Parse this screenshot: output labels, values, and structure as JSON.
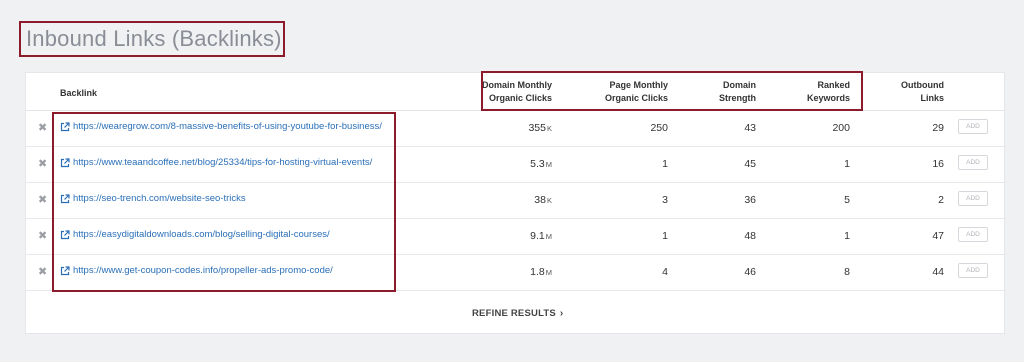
{
  "page_title": "Inbound Links (Backlinks)",
  "columns": {
    "backlink": "Backlink",
    "domain_monthly_clicks": [
      "Domain Monthly",
      "Organic Clicks"
    ],
    "page_monthly_clicks": [
      "Page Monthly",
      "Organic Clicks"
    ],
    "domain_strength": [
      "Domain",
      "Strength"
    ],
    "ranked_keywords": [
      "Ranked",
      "Keywords"
    ],
    "outbound_links": [
      "Outbound",
      "Links"
    ]
  },
  "rows": [
    {
      "url": "https://wearegrow.com/8-massive-benefits-of-using-youtube-for-business/",
      "domain_clicks": "355",
      "domain_clicks_unit": "K",
      "page_clicks": "250",
      "strength": "43",
      "keywords": "200",
      "outbound": "29",
      "add": "ADD"
    },
    {
      "url": "https://www.teaandcoffee.net/blog/25334/tips-for-hosting-virtual-events/",
      "domain_clicks": "5.3",
      "domain_clicks_unit": "M",
      "page_clicks": "1",
      "strength": "45",
      "keywords": "1",
      "outbound": "16",
      "add": "ADD"
    },
    {
      "url": "https://seo-trench.com/website-seo-tricks",
      "domain_clicks": "38",
      "domain_clicks_unit": "K",
      "page_clicks": "3",
      "strength": "36",
      "keywords": "5",
      "outbound": "2",
      "add": "ADD"
    },
    {
      "url": "https://easydigitaldownloads.com/blog/selling-digital-courses/",
      "domain_clicks": "9.1",
      "domain_clicks_unit": "M",
      "page_clicks": "1",
      "strength": "48",
      "keywords": "1",
      "outbound": "47",
      "add": "ADD"
    },
    {
      "url": "https://www.get-coupon-codes.info/propeller-ads-promo-code/",
      "domain_clicks": "1.8",
      "domain_clicks_unit": "M",
      "page_clicks": "4",
      "strength": "46",
      "keywords": "8",
      "outbound": "44",
      "add": "ADD"
    }
  ],
  "remove_symbol": "✖",
  "refine_label": "REFINE RESULTS",
  "refine_chevron": "›",
  "colors": {
    "link": "#2a6fb8",
    "highlight_border": "#8c1c2c",
    "title": "#8a8d96"
  }
}
